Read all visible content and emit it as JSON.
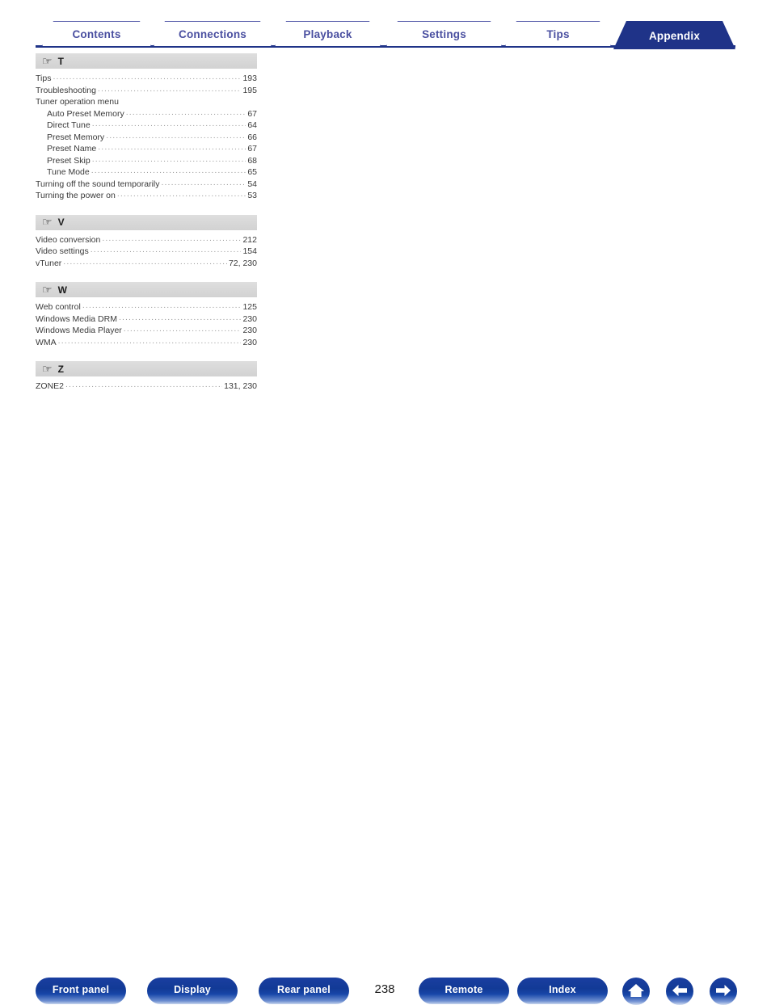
{
  "tabs": [
    {
      "label": "Contents",
      "active": false
    },
    {
      "label": "Connections",
      "active": false
    },
    {
      "label": "Playback",
      "active": false
    },
    {
      "label": "Settings",
      "active": false
    },
    {
      "label": "Tips",
      "active": false
    },
    {
      "label": "Appendix",
      "active": true
    }
  ],
  "index": {
    "sections": [
      {
        "letter": "T",
        "icon": "pointing-hand-icon",
        "entries": [
          {
            "title": "Tips",
            "page": "193",
            "indent": false
          },
          {
            "title": "Troubleshooting",
            "page": "195",
            "indent": false
          },
          {
            "title": "Tuner operation menu",
            "page": "",
            "indent": false
          },
          {
            "title": "Auto Preset Memory",
            "page": "67",
            "indent": true
          },
          {
            "title": "Direct Tune",
            "page": "64",
            "indent": true
          },
          {
            "title": "Preset Memory",
            "page": "66",
            "indent": true
          },
          {
            "title": "Preset Name",
            "page": "67",
            "indent": true
          },
          {
            "title": "Preset Skip",
            "page": "68",
            "indent": true
          },
          {
            "title": "Tune Mode",
            "page": "65",
            "indent": true
          },
          {
            "title": "Turning off the sound temporarily",
            "page": "54",
            "indent": false
          },
          {
            "title": "Turning the power on",
            "page": "53",
            "indent": false
          }
        ]
      },
      {
        "letter": "V",
        "icon": "pointing-hand-icon",
        "entries": [
          {
            "title": "Video conversion",
            "page": "212",
            "indent": false
          },
          {
            "title": "Video settings",
            "page": "154",
            "indent": false
          },
          {
            "title": "vTuner",
            "page": "72, 230",
            "indent": false
          }
        ]
      },
      {
        "letter": "W",
        "icon": "pointing-hand-icon",
        "entries": [
          {
            "title": "Web control",
            "page": "125",
            "indent": false
          },
          {
            "title": "Windows Media DRM",
            "page": "230",
            "indent": false
          },
          {
            "title": "Windows Media Player",
            "page": "230",
            "indent": false
          },
          {
            "title": "WMA",
            "page": "230",
            "indent": false
          }
        ]
      },
      {
        "letter": "Z",
        "icon": "pointing-hand-icon",
        "entries": [
          {
            "title": "ZONE2",
            "page": "131, 230",
            "indent": false
          }
        ]
      }
    ]
  },
  "footer": {
    "buttons": [
      {
        "label": "Front panel"
      },
      {
        "label": "Display"
      },
      {
        "label": "Rear panel"
      },
      {
        "label": "Remote"
      },
      {
        "label": "Index"
      }
    ],
    "page_number": "238",
    "icons": [
      {
        "name": "home-icon"
      },
      {
        "name": "arrow-left-icon"
      },
      {
        "name": "arrow-right-icon"
      }
    ]
  },
  "colors": {
    "brand_blue": "#1f3388",
    "tab_inactive_text": "#4a4fa0",
    "section_header_bg": "#d9d9d9",
    "body_text": "#3a3a3a"
  }
}
